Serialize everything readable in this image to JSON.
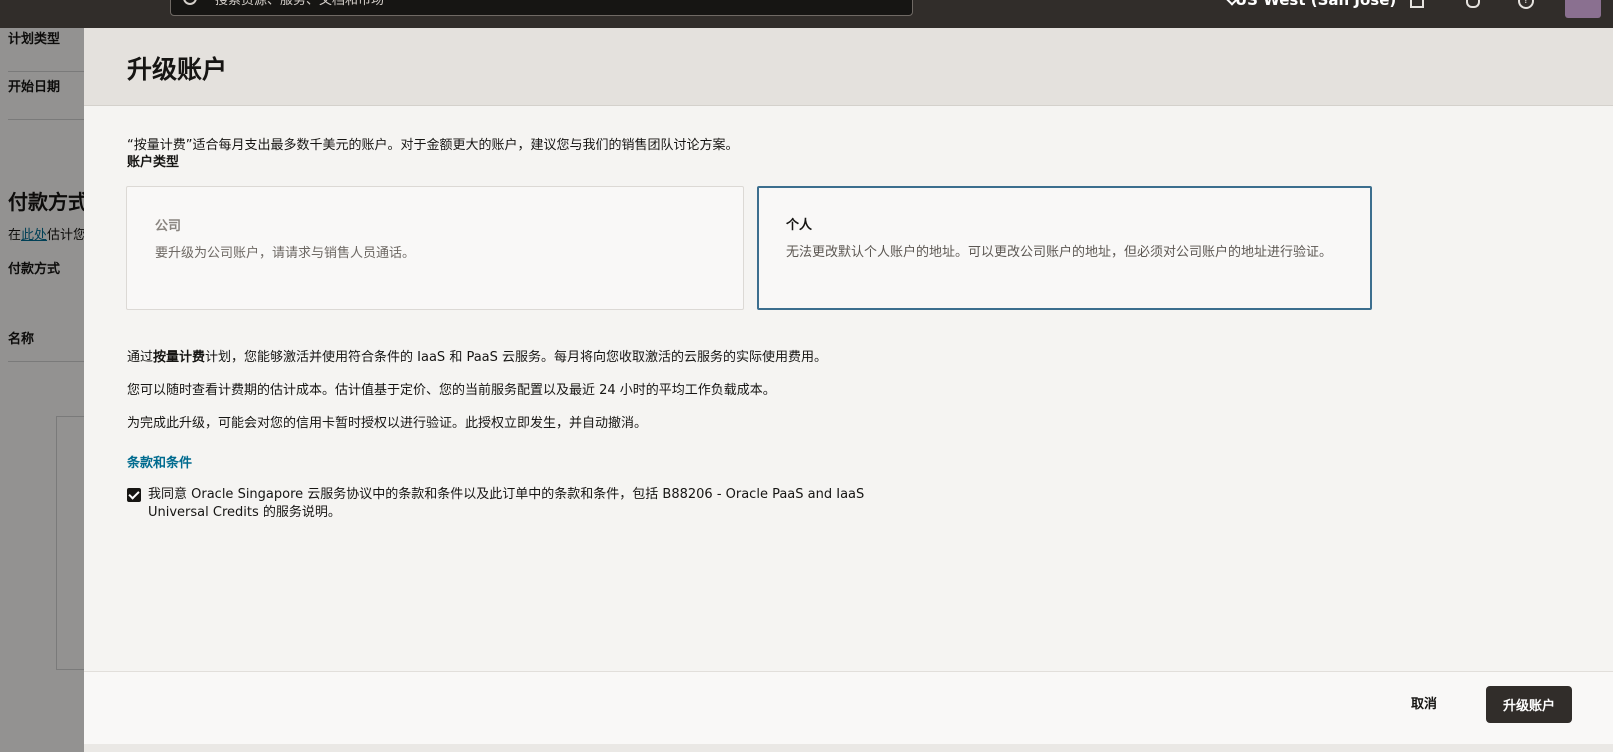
{
  "header": {
    "search_placeholder": "搜索资源、服务、文档和市场",
    "region": "US West (San Jose)"
  },
  "background": {
    "plan_type_label": "计划类型",
    "start_date_label": "开始日期",
    "payment_heading": "付款方式",
    "link_prefix": "在",
    "link_text": "此处",
    "link_suffix": "估计您",
    "payment_method_label": "付款方式",
    "name_label": "名称"
  },
  "drawer": {
    "title": "升级账户",
    "intro": "“按量计费”适合每月支出最多数千美元的账户。对于金额更大的账户，建议您与我们的销售团队讨论方案。",
    "account_type_label": "账户类型",
    "cards": [
      {
        "title": "公司",
        "desc": "要升级为公司账户，请请求与销售人员通话。"
      },
      {
        "title": "个人",
        "desc": "无法更改默认个人账户的地址。可以更改公司账户的地址，但必须对公司账户的地址进行验证。"
      }
    ],
    "para1_prefix": "通过",
    "para1_bold": "按量计费",
    "para1_suffix": "计划，您能够激活并使用符合条件的 IaaS 和 PaaS 云服务。每月将向您收取激活的云服务的实际使用费用。",
    "para2": "您可以随时查看计费期的估计成本。估计值基于定价、您的当前服务配置以及最近 24 小时的平均工作负载成本。",
    "para3": "为完成此升级，可能会对您的信用卡暂时授权以进行验证。此授权立即发生，并自动撤消。",
    "terms_heading": "条款和条件",
    "agree_text": "我同意 Oracle Singapore 云服务协议中的条款和条件以及此订单中的条款和条件，包括 B88206 - Oracle PaaS and IaaS Universal Credits 的服务说明。",
    "agree_checked": true
  },
  "footer": {
    "cancel_label": "取消",
    "upgrade_label": "升级账户"
  }
}
